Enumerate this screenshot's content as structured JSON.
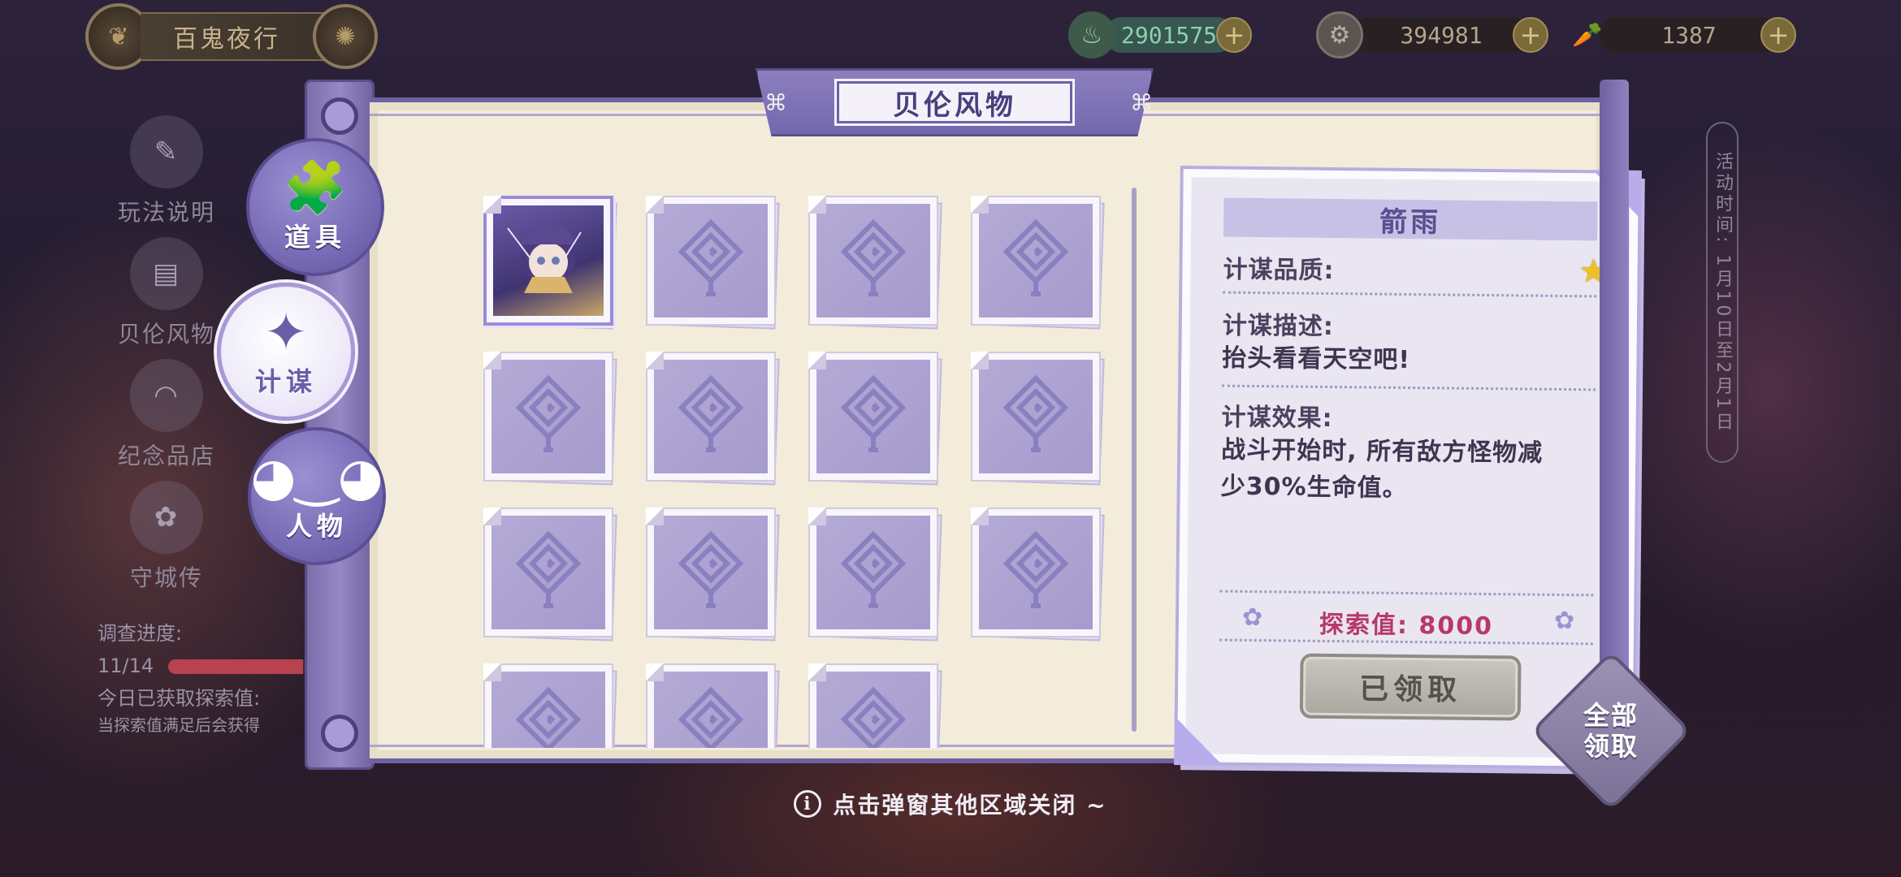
{
  "top_bar": {
    "event_title": "百鬼夜行",
    "resources": [
      {
        "icon": "coin-pot-icon",
        "value": "2901575"
      },
      {
        "icon": "silver-coin-icon",
        "value": "394981"
      },
      {
        "icon": "carrot-icon",
        "value": "1387"
      }
    ]
  },
  "side_menu": {
    "items": [
      "玩法说明",
      "贝伦风物",
      "纪念品店",
      "守城传"
    ],
    "progress_label": "调查进度:",
    "progress_value": "11/14",
    "progress_fraction": 0.79,
    "today_text": "今日已获取探索值:",
    "note_text": "当探索值满足后会获得",
    "event_time_label": "活动时间: 1月10日至2月1日"
  },
  "modal": {
    "title": "贝伦风物",
    "tabs": [
      {
        "label": "道具",
        "icon": "puzzle-icon",
        "active": false
      },
      {
        "label": "计谋",
        "icon": "pinwheel-icon",
        "active": true
      },
      {
        "label": "人物",
        "icon": "cat-mask-icon",
        "active": false
      }
    ],
    "cards": [
      {
        "unlocked": true,
        "name": "portrait-card"
      },
      {
        "unlocked": false
      },
      {
        "unlocked": false
      },
      {
        "unlocked": false
      },
      {
        "unlocked": false
      },
      {
        "unlocked": false
      },
      {
        "unlocked": false
      },
      {
        "unlocked": false
      },
      {
        "unlocked": false
      },
      {
        "unlocked": false
      },
      {
        "unlocked": false
      },
      {
        "unlocked": false
      },
      {
        "unlocked": false
      },
      {
        "unlocked": false
      },
      {
        "unlocked": false
      }
    ],
    "detail": {
      "name": "箭雨",
      "quality_label": "计谋品质:",
      "quality_stars": 1,
      "description_label": "计谋描述:",
      "description": "抬头看看天空吧!",
      "effect_label": "计谋效果:",
      "effect_line1": "战斗开始时, 所有敌方怪物减",
      "effect_line2": "少30%生命值。",
      "explore_label": "探索值: 8000",
      "claimed_label": "已领取"
    },
    "claim_all_line1": "全部",
    "claim_all_line2": "领取"
  },
  "hint": "点击弹窗其他区域关闭 ~",
  "colors": {
    "accent_purple": "#7468ad",
    "explore_pink": "#b8386a",
    "star_gold": "#f0c020"
  }
}
